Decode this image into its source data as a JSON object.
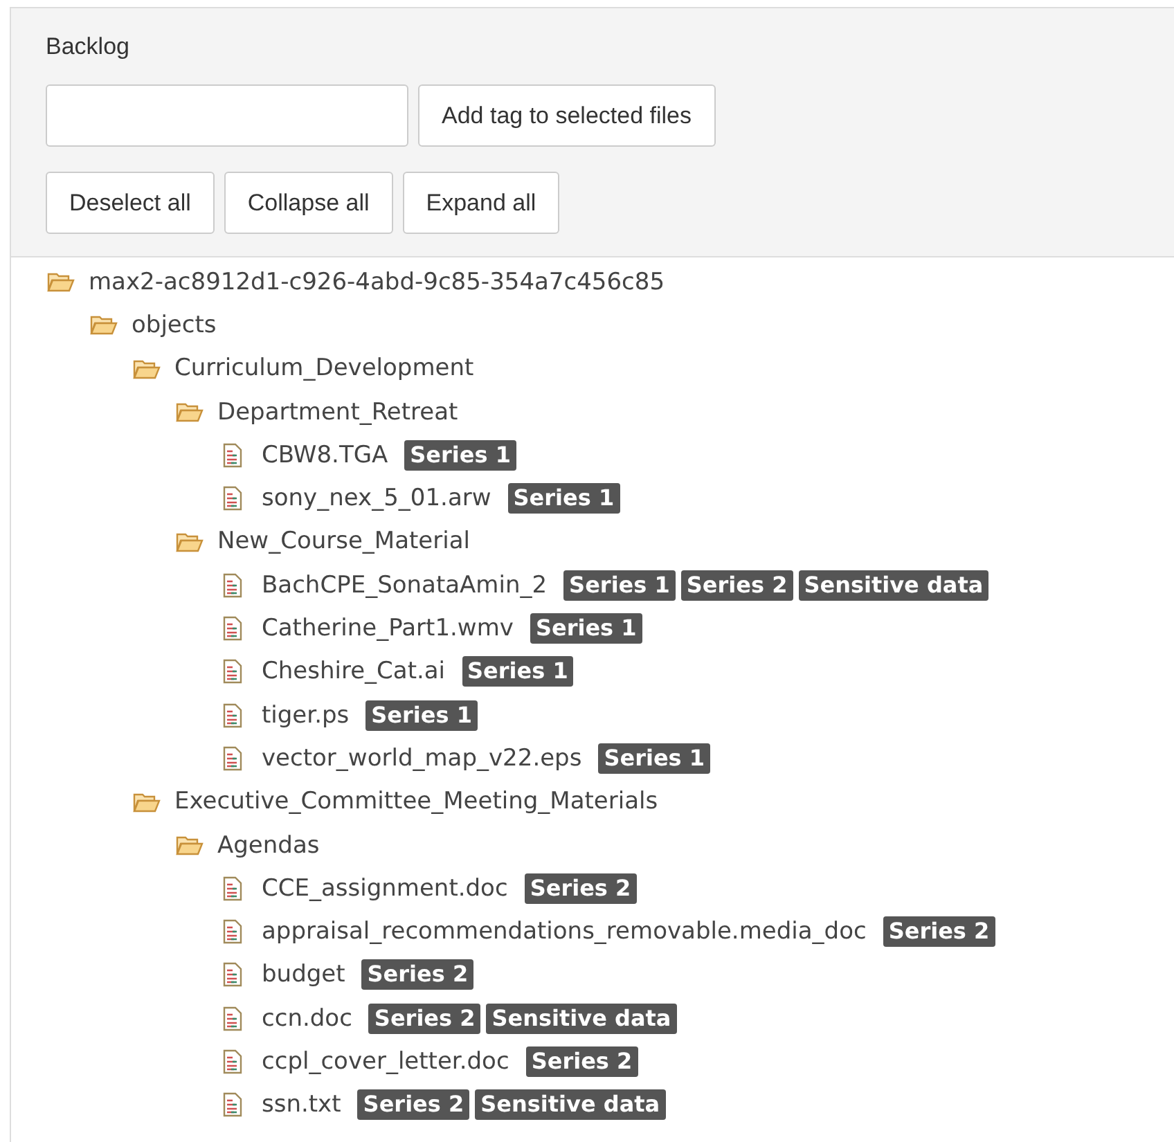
{
  "panel": {
    "title": "Backlog"
  },
  "buttons": [
    "Add tag to selected files",
    "Deselect all",
    "Collapse all",
    "Expand all"
  ],
  "tree": [
    {
      "kind": "folder",
      "name": "max2-ac8912d1-c926-4abd-9c85-354a7c456c85",
      "expanded": true,
      "children": [
        {
          "kind": "folder",
          "name": "objects",
          "expanded": true,
          "children": [
            {
              "kind": "folder",
              "name": "Curriculum_Development",
              "expanded": true,
              "children": [
                {
                  "kind": "folder",
                  "name": "Department_Retreat",
                  "expanded": true,
                  "children": [
                    {
                      "kind": "file",
                      "name": "CBW8.TGA",
                      "tags": [
                        "Series 1"
                      ]
                    },
                    {
                      "kind": "file",
                      "name": "sony_nex_5_01.arw",
                      "tags": [
                        "Series 1"
                      ]
                    }
                  ]
                },
                {
                  "kind": "folder",
                  "name": "New_Course_Material",
                  "expanded": true,
                  "children": [
                    {
                      "kind": "file",
                      "name": "BachCPE_SonataAmin_2",
                      "tags": [
                        "Series 1",
                        "Series 2",
                        "Sensitive data"
                      ]
                    },
                    {
                      "kind": "file",
                      "name": "Catherine_Part1.wmv",
                      "tags": [
                        "Series 1"
                      ]
                    },
                    {
                      "kind": "file",
                      "name": "Cheshire_Cat.ai",
                      "tags": [
                        "Series 1"
                      ]
                    },
                    {
                      "kind": "file",
                      "name": "tiger.ps",
                      "tags": [
                        "Series 1"
                      ]
                    },
                    {
                      "kind": "file",
                      "name": "vector_world_map_v22.eps",
                      "tags": [
                        "Series 1"
                      ]
                    }
                  ]
                }
              ]
            },
            {
              "kind": "folder",
              "name": "Executive_Committee_Meeting_Materials",
              "expanded": true,
              "children": [
                {
                  "kind": "folder",
                  "name": "Agendas",
                  "expanded": true,
                  "children": [
                    {
                      "kind": "file",
                      "name": "CCE_assignment.doc",
                      "tags": [
                        "Series 2"
                      ]
                    },
                    {
                      "kind": "file",
                      "name": "appraisal_recommendations_removable.media_doc",
                      "tags": [
                        "Series 2"
                      ]
                    },
                    {
                      "kind": "file",
                      "name": "budget",
                      "tags": [
                        "Series 2"
                      ]
                    },
                    {
                      "kind": "file",
                      "name": "ccn.doc",
                      "tags": [
                        "Series 2",
                        "Sensitive data"
                      ]
                    },
                    {
                      "kind": "file",
                      "name": "ccpl_cover_letter.doc",
                      "tags": [
                        "Series 2"
                      ]
                    },
                    {
                      "kind": "file",
                      "name": "ssn.txt",
                      "tags": [
                        "Series 2",
                        "Sensitive data"
                      ]
                    }
                  ]
                }
              ]
            }
          ]
        }
      ]
    }
  ]
}
